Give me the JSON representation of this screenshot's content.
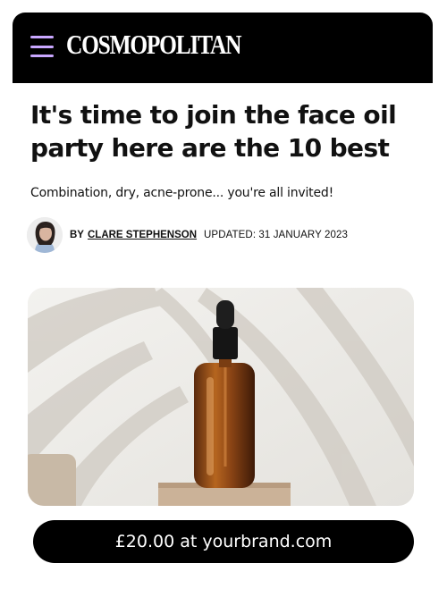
{
  "header": {
    "logo": "COSMOPOLITAN",
    "menu_icon": "hamburger-menu-icon",
    "background": "#000000",
    "menu_color": "#c9a7ff"
  },
  "article": {
    "title": "It's time to join the face oil party here are the 10 best",
    "subtitle": "Combination, dry, acne-prone... you're all invited!",
    "byline_prefix": "BY",
    "author": "CLARE STEPHENSON",
    "updated": "UPDATED: 31 JANUARY 2023"
  },
  "product": {
    "image": "amber-dropper-bottle-photo",
    "buy_label": "£20.00 at yourbrand.com"
  }
}
